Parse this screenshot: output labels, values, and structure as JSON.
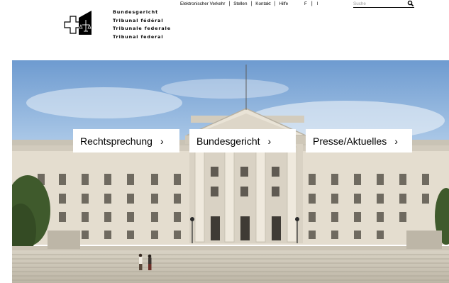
{
  "header": {
    "institution_names": [
      "Bundesgericht",
      "Tribunal fédéral",
      "Tribunale federale",
      "Tribunal federal"
    ],
    "meta_nav": [
      "Elektronischer Verkehr",
      "Stellen",
      "Kontakt",
      "Hilfe"
    ],
    "languages": [
      "F",
      "I"
    ],
    "search": {
      "placeholder": "Suche",
      "value": "",
      "icon": "search-icon"
    }
  },
  "hero": {
    "image": "federal-court-building-photo",
    "nav_tiles": [
      {
        "label": "Rechtsprechung",
        "chevron": "›"
      },
      {
        "label": "Bundesgericht",
        "chevron": "›"
      },
      {
        "label": "Presse/Aktuelles",
        "chevron": "›"
      }
    ]
  },
  "colors": {
    "text": "#000000",
    "background": "#ffffff",
    "tile": "#ffffff"
  }
}
